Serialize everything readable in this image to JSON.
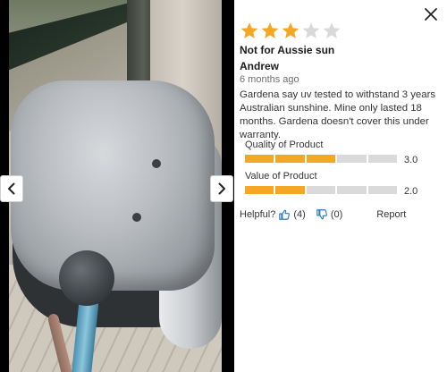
{
  "review": {
    "rating_stars": 3,
    "rating_max": 5,
    "title": "Not for Aussie sun",
    "author": "Andrew",
    "date": "6 months ago",
    "text": "Gardena say uv tested to withstand 3 years Australian sunshine. Mine only lasted 18 months. Gardena doesn't cover this under warranty.",
    "ratings": [
      {
        "label": "Quality of Product",
        "value": "3.0",
        "segments_on": 3,
        "segments_total": 5
      },
      {
        "label": "Value of Product",
        "value": "2.0",
        "segments_on": 2,
        "segments_total": 5
      }
    ],
    "helpful": {
      "label": "Helpful?",
      "up_count": "(4)",
      "down_count": "(0)"
    },
    "report_label": "Report"
  },
  "icons": {
    "close": "close-icon",
    "prev": "chevron-left-icon",
    "next": "chevron-right-icon",
    "thumb_up": "thumbs-up-icon",
    "thumb_down": "thumbs-down-icon",
    "star": "star-icon"
  },
  "colors": {
    "star_filled": "#f5a623",
    "star_empty": "#d9d9d9",
    "bar_on": "#f5a623",
    "bar_off": "#dadada",
    "thumb": "#2a7abf"
  }
}
